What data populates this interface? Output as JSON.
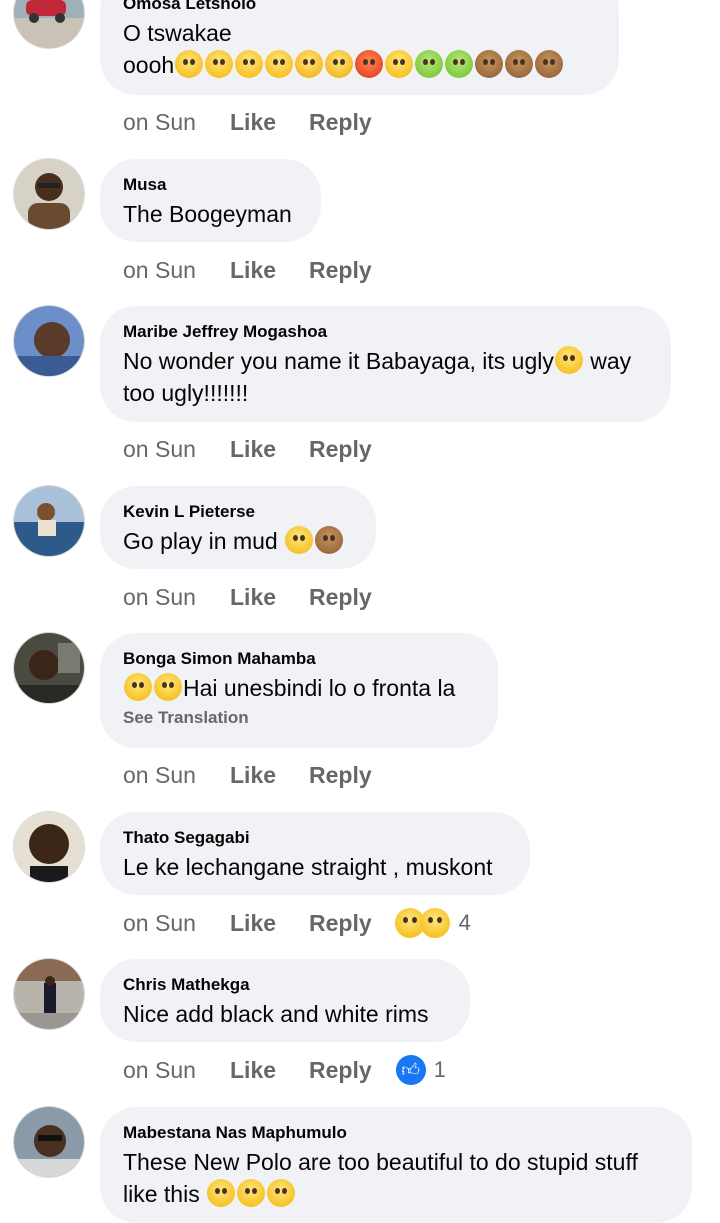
{
  "comments": [
    {
      "author": "Omosa Letsholo",
      "text": "O tswakae",
      "text2": "oooh",
      "time": "on Sun",
      "like": "Like",
      "reply": "Reply"
    },
    {
      "author": "Musa",
      "text": "The Boogeyman",
      "time": "on Sun",
      "like": "Like",
      "reply": "Reply"
    },
    {
      "author": "Maribe Jeffrey Mogashoa",
      "text": "No wonder you name it Babayaga, its ugly",
      "text_tail": " way",
      "text2": "too ugly!!!!!!!",
      "time": "on Sun",
      "like": "Like",
      "reply": "Reply"
    },
    {
      "author": "Kevin L Pieterse",
      "text": "Go play in mud",
      "time": "on Sun",
      "like": "Like",
      "reply": "Reply"
    },
    {
      "author": "Bonga Simon Mahamba",
      "text": "Hai unesbindi lo o fronta la",
      "see_translation": "See Translation",
      "time": "on Sun",
      "like": "Like",
      "reply": "Reply"
    },
    {
      "author": "Thato Segagabi",
      "text": "Le ke lechangane straight , muskont",
      "time": "on Sun",
      "like": "Like",
      "reply": "Reply",
      "reaction_count": "4"
    },
    {
      "author": "Chris Mathekga",
      "text": "Nice add black and white rims",
      "time": "on Sun",
      "like": "Like",
      "reply": "Reply",
      "reaction_count": "1"
    },
    {
      "author": "Mabestana Nas Maphumulo",
      "text": "These New Polo are too beautiful to do stupid stuff",
      "text2": "like this",
      "time": "on Sun",
      "like": "Like",
      "reply": "Reply"
    }
  ],
  "icons": {
    "like_reaction": "thumbs-up-icon",
    "haha_reaction": "laughing-emoji-icon",
    "wow_reaction": "surprised-emoji-icon"
  },
  "colors": {
    "bubble": "#f0f2f5",
    "secondary_text": "#65676b",
    "like_blue": "#1877f2"
  }
}
